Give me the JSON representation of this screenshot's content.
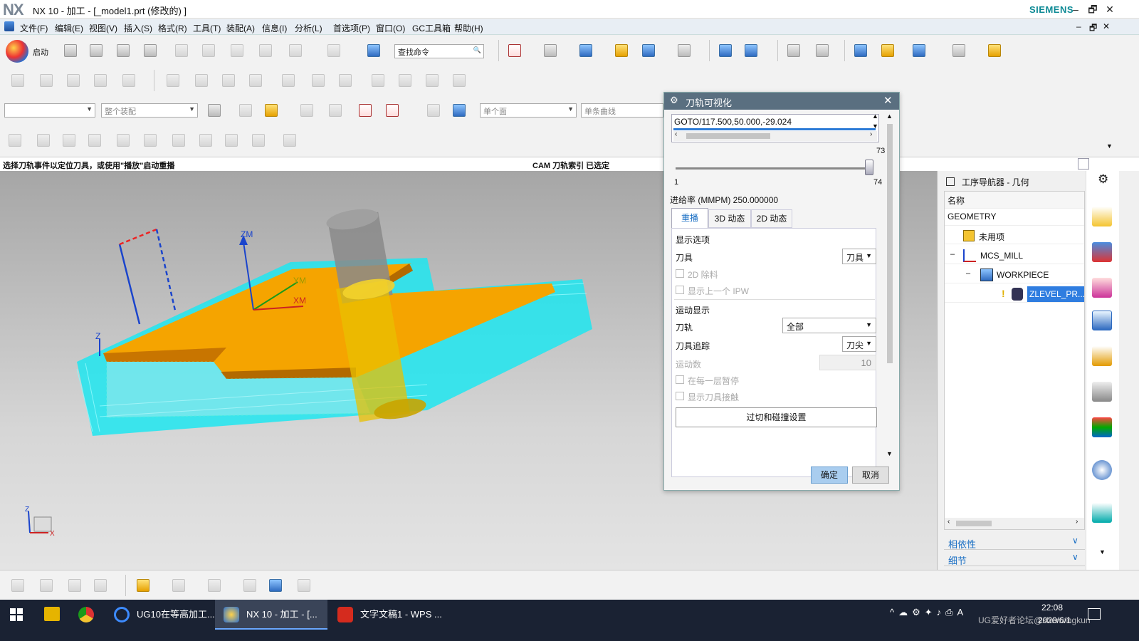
{
  "app": {
    "logo": "NX",
    "window_title": "NX 10 - 加工 - [_model1.prt  (修改的) ]",
    "brand": "SIEMENS",
    "win_controls": [
      "–",
      "🗗",
      "✕"
    ]
  },
  "menu": {
    "items": [
      "文件(F)",
      "编辑(E)",
      "视图(V)",
      "插入(S)",
      "格式(R)",
      "工具(T)",
      "装配(A)",
      "信息(I)",
      "分析(L)",
      "首选项(P)",
      "窗口(O)",
      "GC工具箱",
      "帮助(H)"
    ]
  },
  "toolbar": {
    "start_label": "启动",
    "search_placeholder": "查找命令",
    "filter_all": "",
    "assembly_scope": "整个装配",
    "face_rule": "单个面",
    "curve_rule": "单条曲线"
  },
  "status": {
    "left": "选择刀轨事件以定位刀具，或使用\"播放\"启动重播",
    "right": "CAM 刀轨索引 已选定"
  },
  "viewport": {
    "axis_zm": "ZM",
    "axis_ym": "YM",
    "axis_xm": "XM",
    "axis_z": "Z",
    "triad_z": "Z",
    "triad_x": "X"
  },
  "dialog": {
    "title": "刀轨可视化",
    "goto_text": "GOTO/117.500,50.000,-29.024",
    "slider": {
      "current": "73",
      "min": "1",
      "max": "74",
      "fraction": 0.9863
    },
    "feedrate": "进给率 (MMPM) 250.000000",
    "tabs": [
      "重播",
      "3D 动态",
      "2D 动态"
    ],
    "display_options_title": "显示选项",
    "tool_label": "刀具",
    "tool_value": "刀具",
    "chk_2d": "2D 除料",
    "chk_ipw": "显示上一个 IPW",
    "motion_title": "运动显示",
    "path_label": "刀轨",
    "path_value": "全部",
    "trace_label": "刀具追踪",
    "trace_value": "刀尖",
    "motion_count_label": "运动数",
    "motion_count_value": "10",
    "chk_pause": "在每一层暂停",
    "chk_contact": "显示刀具接触",
    "gouge_button": "过切和碰撞设置",
    "ok": "确定",
    "cancel": "取消"
  },
  "navigator": {
    "title": "工序导航器 - 几何",
    "column": "名称",
    "rows": [
      "GEOMETRY",
      "未用项",
      "MCS_MILL",
      "WORKPIECE",
      "ZLEVEL_PR..."
    ],
    "dependencies": "相依性",
    "details": "细节"
  },
  "taskbar": {
    "items": [
      "UG10在等高加工...",
      "NX 10 - 加工 - [...",
      "文字文稿1 - WPS ..."
    ],
    "time": "22:08",
    "date": "2020/6/1",
    "watermark": "UG爱好者论坛@shenxingkun"
  },
  "colors": {
    "accent": "#0d8a95",
    "dialog_header": "#5a6f80",
    "part_orange": "#f5a400",
    "toolpath_cyan": "#1ee6f0",
    "tool_gray": "#8a8a8a",
    "tool_yellow": "#e8c000",
    "taskbar": "#1a2233",
    "link_blue": "#1a6fc4"
  }
}
